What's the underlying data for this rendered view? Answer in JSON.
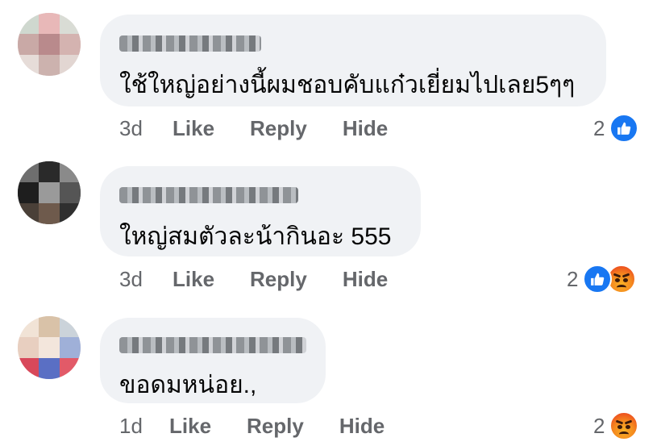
{
  "comments": [
    {
      "text": "ใช้ใหญ่อย่างนี้ผมชอบคับแก๋วเยี่ยมไปเลย5ๆๆ",
      "time": "3d",
      "actions": {
        "like": "Like",
        "reply": "Reply",
        "hide": "Hide"
      },
      "reaction_count": "2",
      "reactions": [
        "like-icon"
      ]
    },
    {
      "text": "ใหญ่สมตัวละน้ากินอะ  555",
      "time": "3d",
      "actions": {
        "like": "Like",
        "reply": "Reply",
        "hide": "Hide"
      },
      "reaction_count": "2",
      "reactions": [
        "like-icon",
        "angry-icon"
      ]
    },
    {
      "text": "ขอดมหน่อย.,",
      "time": "1d",
      "actions": {
        "like": "Like",
        "reply": "Reply",
        "hide": "Hide"
      },
      "reaction_count": "2",
      "reactions": [
        "angry-icon"
      ]
    }
  ],
  "colors": {
    "bubble": "#f0f2f5",
    "secondary_text": "#65676b",
    "like_blue": "#1877f2"
  }
}
